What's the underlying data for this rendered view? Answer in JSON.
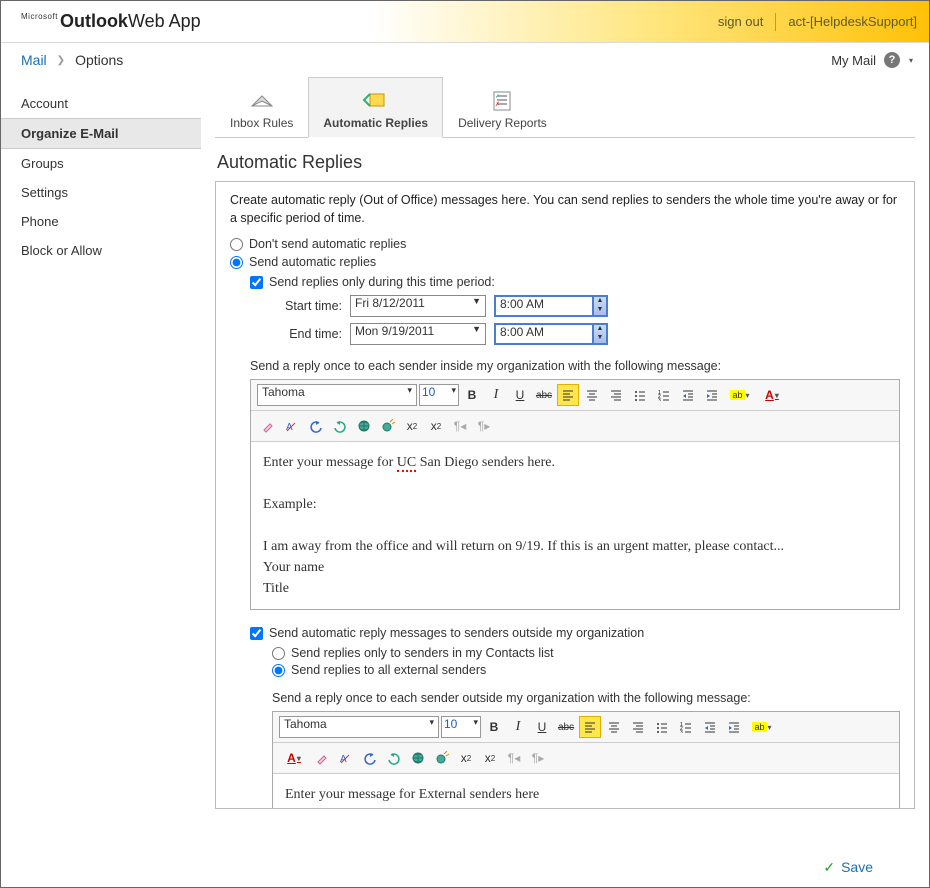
{
  "header": {
    "logo_ms": "Microsoft",
    "logo_outlook": "Outlook",
    "logo_webapp": "Web App",
    "sign_out": "sign out",
    "user": "act-[HelpdeskSupport]"
  },
  "breadcrumb": {
    "mail": "Mail",
    "options": "Options",
    "mymail": "My Mail"
  },
  "sidebar": {
    "items": [
      "Account",
      "Organize E-Mail",
      "Groups",
      "Settings",
      "Phone",
      "Block or Allow"
    ]
  },
  "tabs": {
    "inbox": "Inbox Rules",
    "auto": "Automatic Replies",
    "delivery": "Delivery Reports"
  },
  "page": {
    "title": "Automatic Replies",
    "intro": "Create automatic reply (Out of Office) messages here. You can send replies to senders the whole time you're away or for a specific period of time.",
    "r_dont": "Don't send automatic replies",
    "r_send": "Send automatic replies",
    "chk_period": "Send replies only during this time period:",
    "start_label": "Start time:",
    "end_label": "End time:",
    "start_date": "Fri 8/12/2011",
    "start_time": "8:00 AM",
    "end_date": "Mon 9/19/2011",
    "end_time": "8:00 AM",
    "msg_inside": "Send a reply once to each sender inside my organization with the following message:",
    "font": "Tahoma",
    "size": "10",
    "body_l1_a": "Enter your message for ",
    "body_l1_uc": "UC",
    "body_l1_b": " San Diego senders here.",
    "body_l2": "Example:",
    "body_l3": "I am away from the office and will return on 9/19. If this is an urgent matter, please contact...",
    "body_l4": "Your name",
    "body_l5": "Title",
    "chk_outside": "Send automatic reply messages to senders outside my organization",
    "r_contacts": "Send replies only to senders in my Contacts list",
    "r_all": "Send replies to all external senders",
    "msg_outside": "Send a reply once to each sender outside my organization with the following message:",
    "body2": "Enter your  message for External senders here"
  },
  "footer": {
    "save": "Save"
  }
}
